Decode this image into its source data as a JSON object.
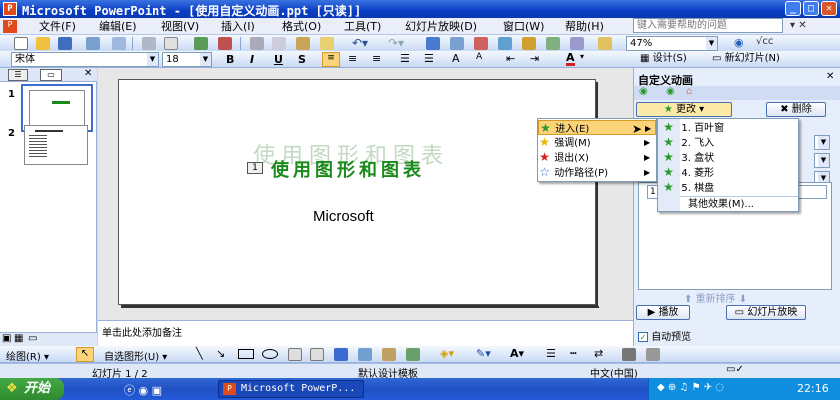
{
  "window": {
    "title": "Microsoft PowerPoint - [使用自定义动画.ppt [只读]]",
    "app_icon": "powerpoint-icon"
  },
  "menu": {
    "items": [
      "文件(F)",
      "编辑(E)",
      "视图(V)",
      "插入(I)",
      "格式(O)",
      "工具(T)",
      "幻灯片放映(D)",
      "窗口(W)",
      "帮助(H)"
    ],
    "help_placeholder": "键入需要帮助的问题"
  },
  "toolbar": {
    "zoom": "47%",
    "design_label": "设计(S)",
    "new_slide_label": "新幻灯片(N)"
  },
  "format": {
    "font": "宋体",
    "size": "18",
    "bold": "B",
    "italic": "I",
    "underline": "U",
    "shadow": "S"
  },
  "outline": {
    "slide_numbers": [
      "1",
      "2"
    ]
  },
  "slide": {
    "title": "使用图形和图表",
    "shadow_title": "使用图形和图表",
    "subtitle": "Microsoft",
    "tag": "1"
  },
  "notes_placeholder": "单击此处添加备注",
  "taskpane": {
    "title": "自定义动画",
    "change_label": "更改",
    "delete_label": "删除",
    "play_label": "播放",
    "slideshow_label": "幻灯片放映",
    "reorder_label": "重新排序",
    "autopreview_label": "自动预览",
    "list_item_number": "1"
  },
  "effect_menu": {
    "items": [
      {
        "label": "进入(E)",
        "icon": "green-star-icon",
        "color": "#2a9a2a"
      },
      {
        "label": "强调(M)",
        "icon": "yellow-star-icon",
        "color": "#e8b800"
      },
      {
        "label": "退出(X)",
        "icon": "red-star-icon",
        "color": "#d02020"
      },
      {
        "label": "动作路径(P)",
        "icon": "path-star-icon",
        "color": "#3b6fd0"
      }
    ]
  },
  "submenu": {
    "items": [
      "1. 百叶窗",
      "2. 飞入",
      "3. 盒状",
      "4. 菱形",
      "5. 棋盘"
    ],
    "more": "其他效果(M)..."
  },
  "drawing": {
    "draw_label": "绘图(R)",
    "autoshapes_label": "自选图形(U)"
  },
  "status": {
    "slide": "幻灯片 1 / 2",
    "design": "默认设计模板",
    "language": "中文(中国)"
  },
  "taskbar": {
    "start": "开始",
    "app": "Microsoft PowerP...",
    "clock": "22:16"
  }
}
